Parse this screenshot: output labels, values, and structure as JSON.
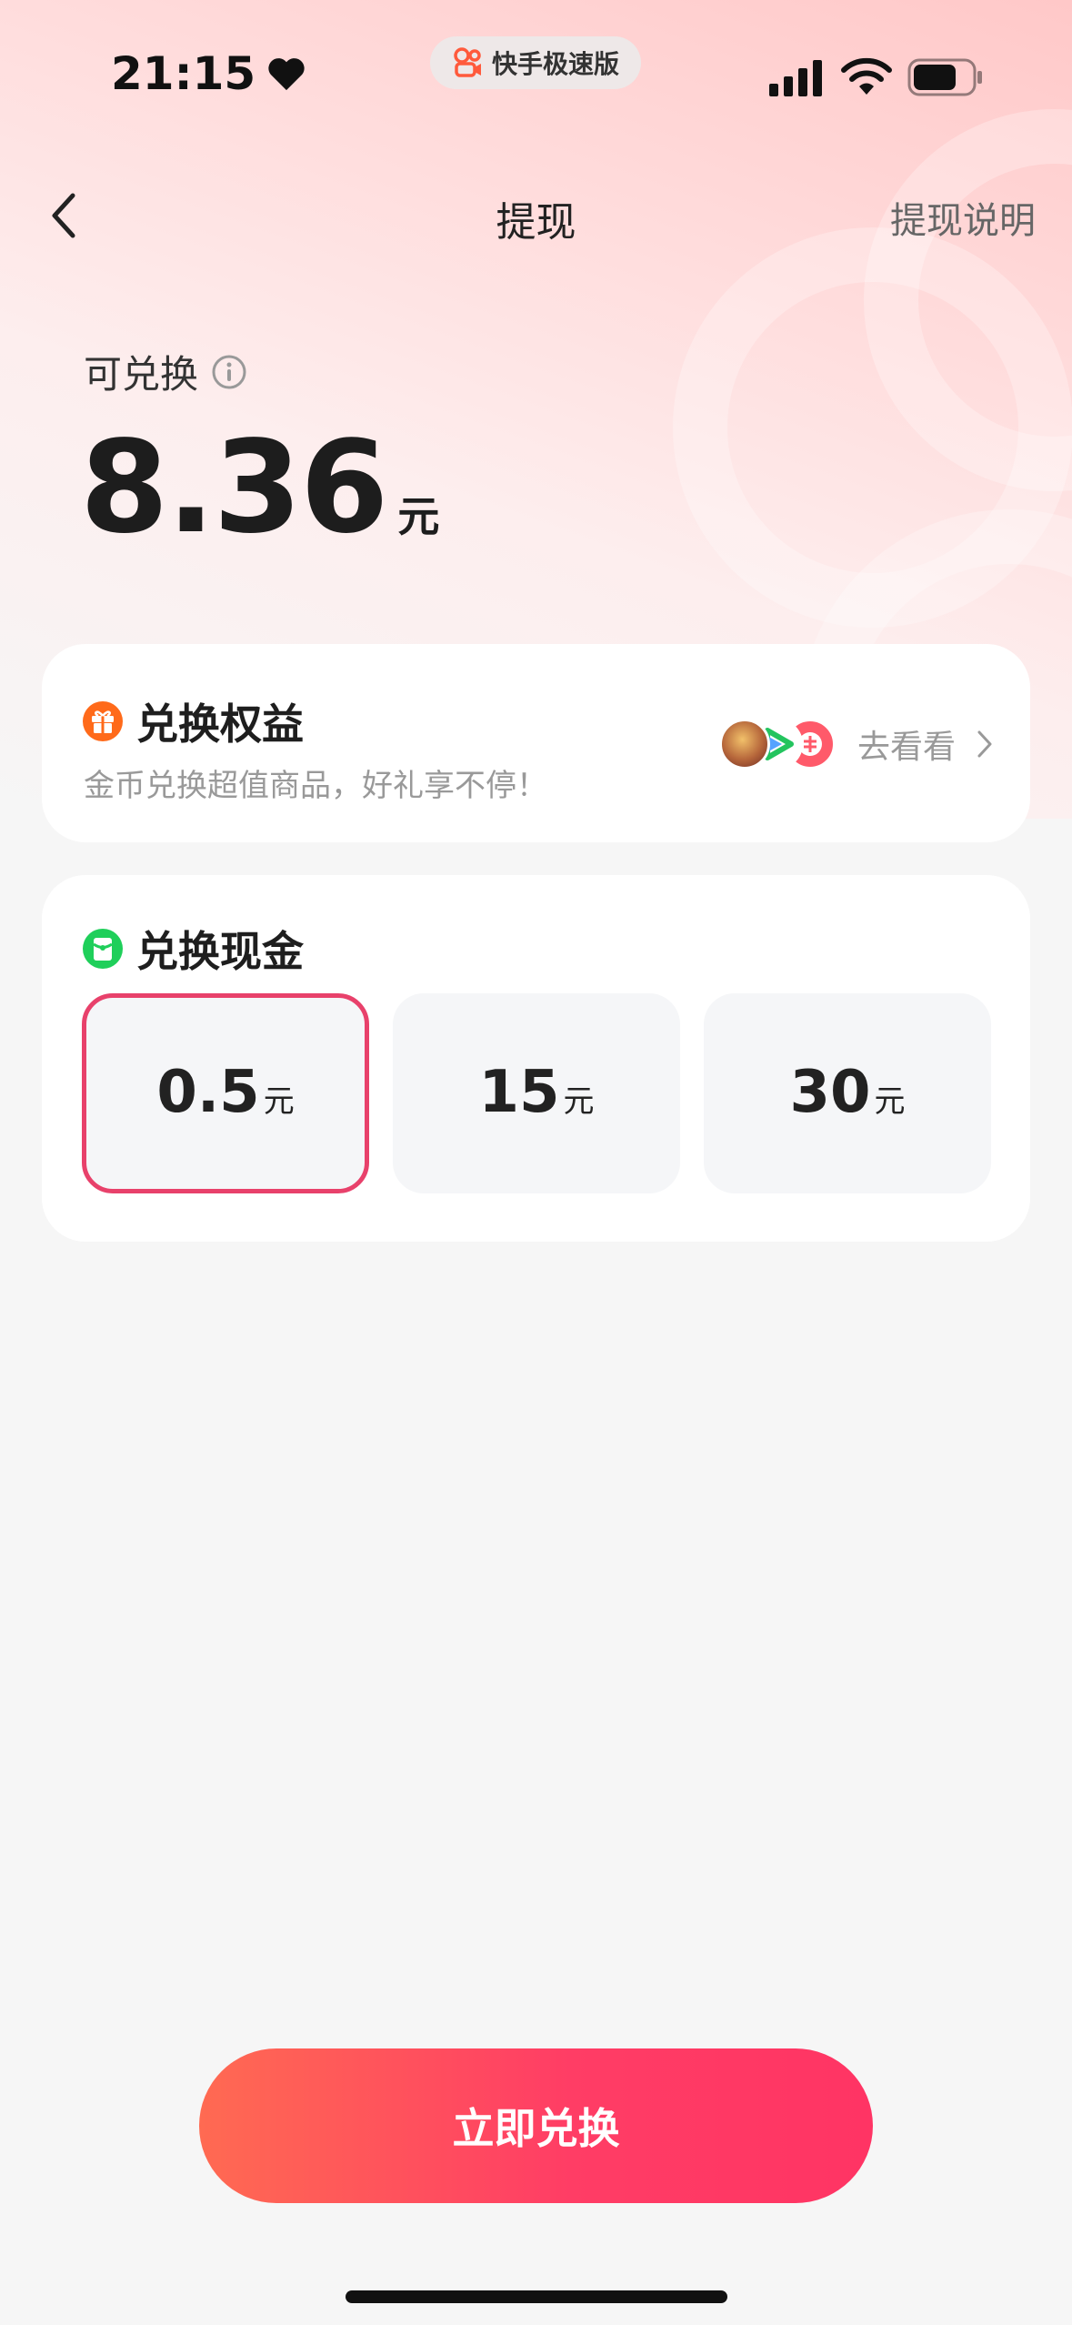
{
  "status_bar": {
    "time": "21:15",
    "app_name": "快手极速版"
  },
  "nav": {
    "title": "提现",
    "help_label": "提现说明"
  },
  "balance": {
    "label": "可兑换",
    "amount": "8.36",
    "unit": "元"
  },
  "benefits": {
    "title": "兑换权益",
    "subtitle": "金币兑换超值商品，好礼享不停！",
    "link_label": "去看看"
  },
  "cash": {
    "title": "兑换现金",
    "options": [
      {
        "value": "0.5",
        "unit": "元",
        "selected": true
      },
      {
        "value": "15",
        "unit": "元",
        "selected": false
      },
      {
        "value": "30",
        "unit": "元",
        "selected": false
      }
    ]
  },
  "cta": {
    "label": "立即兑换"
  },
  "colors": {
    "accent": "#ff3d65",
    "selected_border": "#e8416b",
    "benefit_icon": "#ff6a1a",
    "cash_icon": "#1fcf5a"
  },
  "icons": {
    "back": "chevron-left-icon",
    "info": "info-icon",
    "benefit": "gift-icon",
    "cash": "cash-icon",
    "link": "chevron-right-icon"
  }
}
